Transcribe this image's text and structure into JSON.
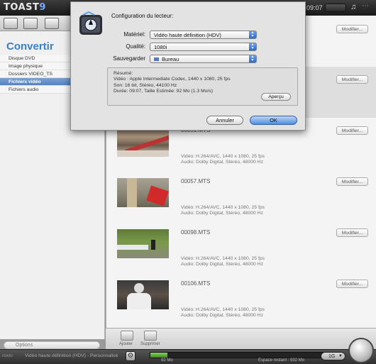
{
  "app": {
    "name": "TOAST",
    "version": "9"
  },
  "clock": "09:07",
  "sidebar": {
    "title": "Convertir",
    "items": [
      {
        "label": "Disque DVD"
      },
      {
        "label": "Image physique"
      },
      {
        "label": "Dossiers VIDEO_TS"
      },
      {
        "label": "Fichiers vidéo",
        "selected": true
      },
      {
        "label": "Fichiers audio"
      }
    ],
    "options_label": "Options"
  },
  "items": [
    {
      "filename": "",
      "video": "",
      "audio": "",
      "modify": "Modifier..."
    },
    {
      "filename": "",
      "video": "",
      "audio": "",
      "modify": "Modifier..."
    },
    {
      "filename": "00051.MTS",
      "video": "Vidéo: H.264/AVC, 1440 x 1080, 25 fps",
      "audio": "Audio: Dolby Digital, Stéréo, 48000 Hz",
      "modify": "Modifier..."
    },
    {
      "filename": "00057.MTS",
      "video": "Vidéo: H.264/AVC, 1440 x 1080, 25 fps",
      "audio": "Audio: Dolby Digital, Stéréo, 48000 Hz",
      "modify": "Modifier..."
    },
    {
      "filename": "00098.MTS",
      "video": "Vidéo: H.264/AVC, 1440 x 1080, 25 fps",
      "audio": "Audio: Dolby Digital, Stéréo, 48000 Hz",
      "modify": "Modifier..."
    },
    {
      "filename": "00106.MTS",
      "video": "Vidéo: H.264/AVC, 1440 x 1080, 25 fps",
      "audio": "Audio: Dolby Digital, Stéréo, 48000 Hz",
      "modify": "Modifier..."
    }
  ],
  "bottom": {
    "add_label": "Ajouter",
    "remove_label": "Supprimer"
  },
  "footer": {
    "brand": "roxio",
    "status": "Vidéo haute définition (HDV) - Personnalisé",
    "meter_fill": 0.1,
    "used": "92 Mo",
    "remaining": "Espace restant : 932 Mo",
    "capacity": "1G"
  },
  "dialog": {
    "title": "Configuration du lecteur:",
    "materiel_label": "Matériel:",
    "materiel_value": "Vidéo haute définition (HDV)",
    "qualite_label": "Qualité:",
    "qualite_value": "1080i",
    "sauvegarder_label": "Sauvegarder",
    "sauvegarder_value": "Bureau",
    "summary": {
      "heading": "Résumé:",
      "video": "Vidéo : Apple Intermediate Codec, 1440 x 1080, 25 fps",
      "son": "Son: 16 bit, Stéréo, 44100 Hz",
      "duree": "Durée: 09:07, Taille Estimée: 92 Mo (1.3 Mo/s)"
    },
    "apercu_label": "Aperçu",
    "cancel_label": "Annuler",
    "ok_label": "OK"
  }
}
